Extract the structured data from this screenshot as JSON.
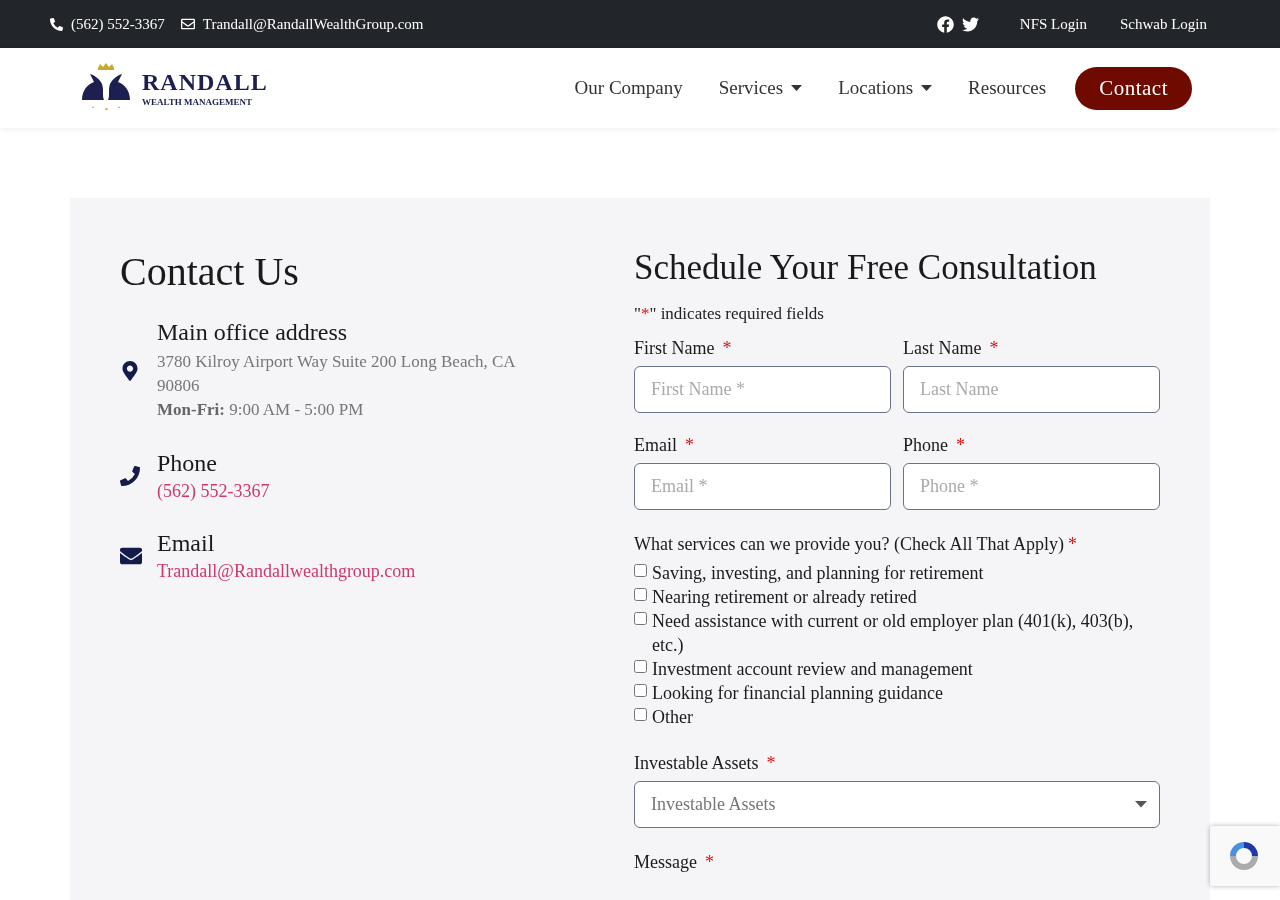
{
  "topbar": {
    "phone": "(562) 552-3367",
    "email": "Trandall@RandallWealthGroup.com",
    "links": [
      "NFS Login",
      "Schwab Login"
    ]
  },
  "header": {
    "logo": {
      "name": "RANDALL",
      "tagline": "WEALTH MANAGEMENT"
    },
    "nav": [
      {
        "label": "Our Company",
        "dropdown": false
      },
      {
        "label": "Services",
        "dropdown": true
      },
      {
        "label": "Locations",
        "dropdown": true
      },
      {
        "label": "Resources",
        "dropdown": false
      }
    ],
    "cta": "Contact"
  },
  "contact": {
    "title": "Contact Us",
    "items": [
      {
        "kind": "address",
        "heading": "Main office address",
        "lines": [
          "3780 Kilroy Airport Way Suite 200 Long Beach, CA 90806",
          "**Mon-Fri:** 9:00 AM - 5:00 PM"
        ]
      },
      {
        "kind": "phone",
        "heading": "Phone",
        "link": "(562) 552-3367"
      },
      {
        "kind": "email",
        "heading": "Email",
        "link": "Trandall@Randallwealthgroup.com"
      }
    ]
  },
  "form": {
    "title": "Schedule Your Free Consultation",
    "note": {
      "open": "\"",
      "mark": "*",
      "text": "\" indicates required fields"
    },
    "fields": [
      {
        "label": "First Name",
        "mark": "*",
        "placeholder": "First Name *"
      },
      {
        "label": "Last Name",
        "mark": "*",
        "placeholder": "Last Name"
      },
      {
        "label": "Email",
        "mark": "*",
        "placeholder": "Email *"
      },
      {
        "label": "Phone",
        "mark": "*",
        "placeholder": "Phone *"
      }
    ],
    "services": {
      "question": "What services can we provide you? (Check All That Apply)",
      "mark": "*",
      "options": [
        {
          "label": "Saving, investing, and planning for retirement",
          "checked": false
        },
        {
          "label": "Nearing retirement or already retired",
          "checked": false
        },
        {
          "label": "Need assistance with current or old employer plan (401(k), 403(b), etc.)",
          "checked": false
        },
        {
          "label": "Investment account review and management",
          "checked": false
        },
        {
          "label": "Looking for financial planning guidance",
          "checked": false
        },
        {
          "label": "Other",
          "checked": false
        }
      ]
    },
    "assets": {
      "label": "Investable Assets",
      "mark": "*",
      "placeholder": "Investable Assets"
    },
    "message": {
      "label": "Message",
      "mark": "*"
    }
  }
}
